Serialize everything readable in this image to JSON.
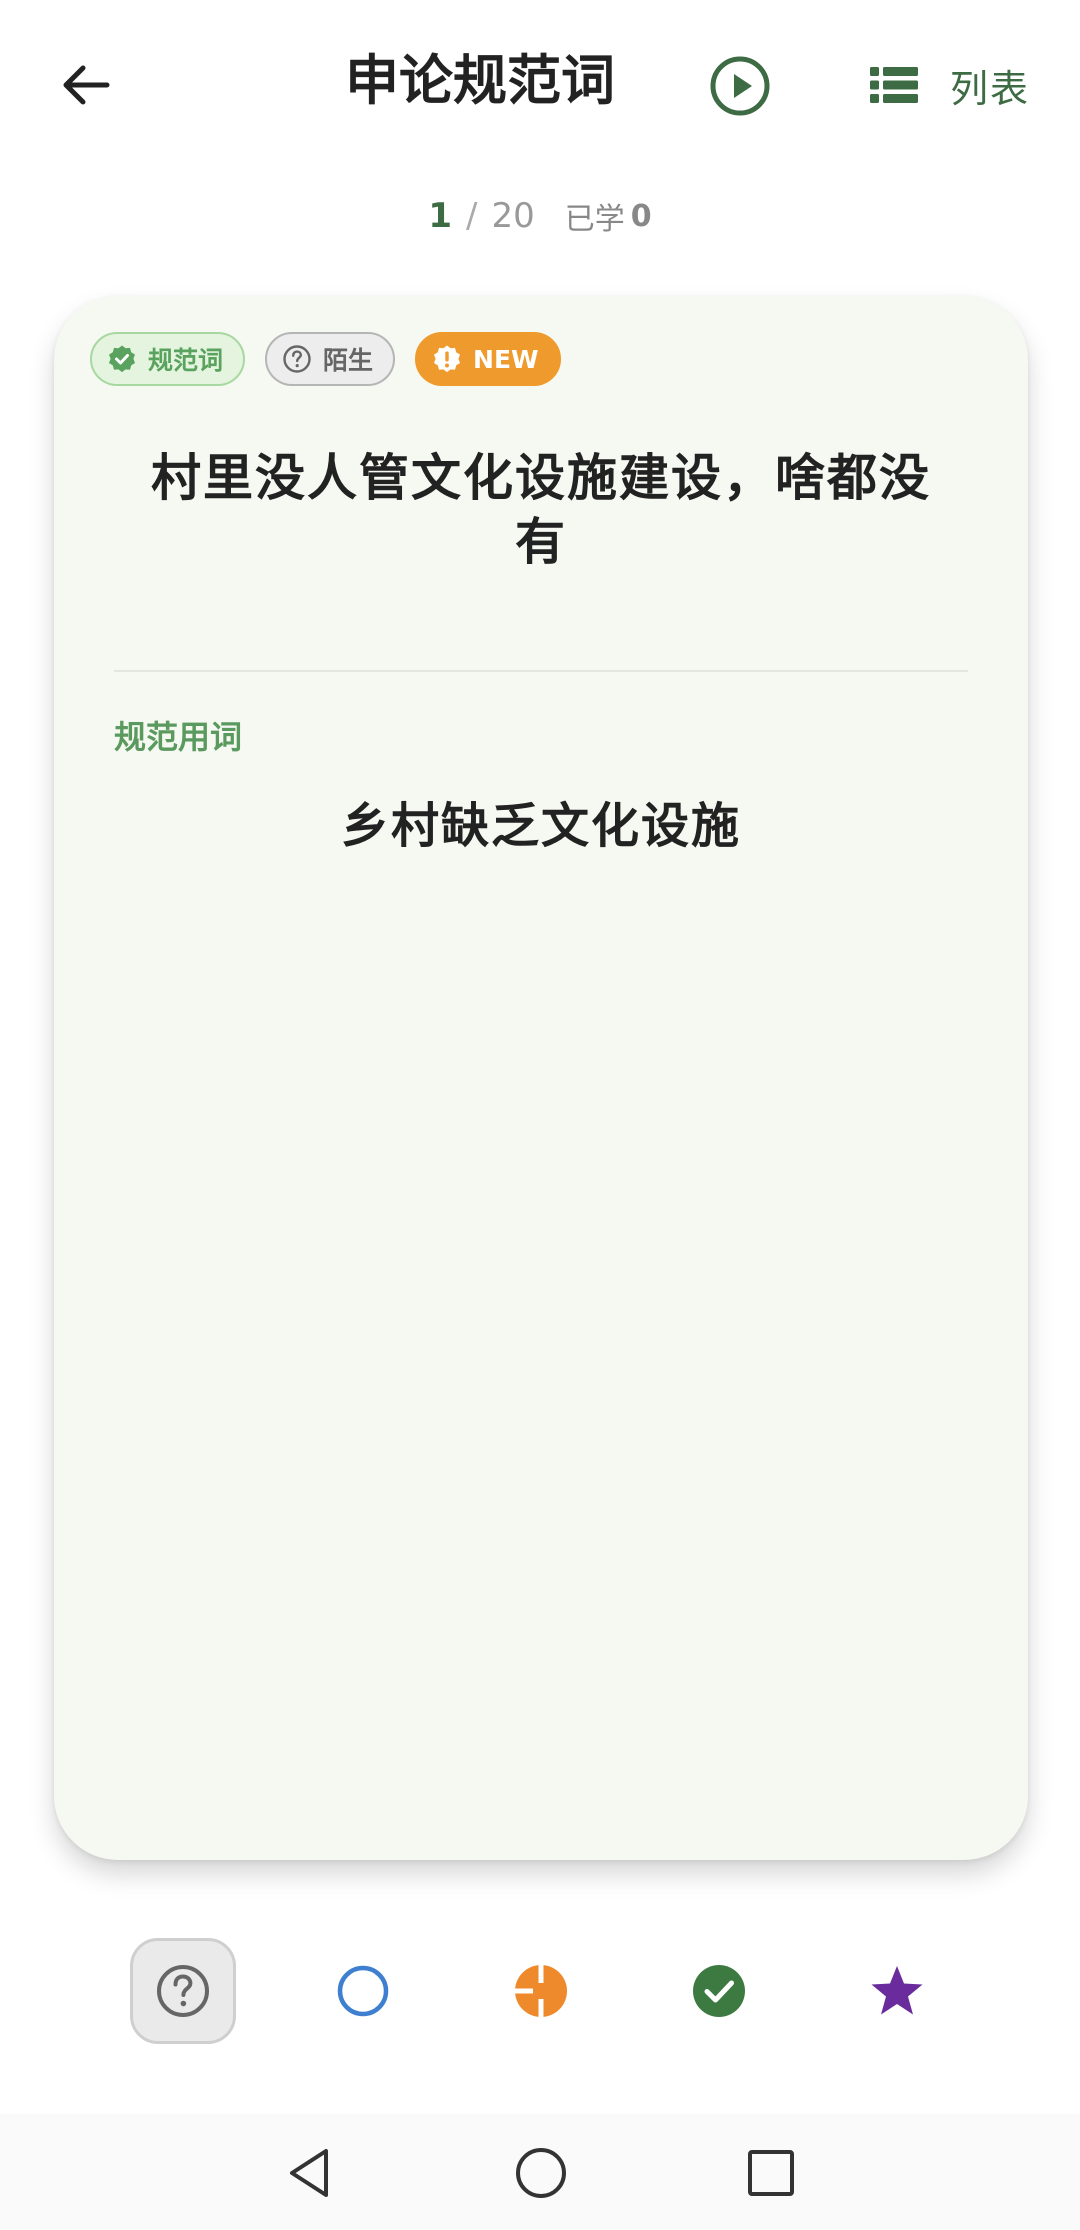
{
  "header": {
    "title": "申论规范词",
    "list_label": "列表"
  },
  "progress": {
    "current": "1",
    "separator": "/",
    "total": "20",
    "learned_label": "已学",
    "learned_count": "0"
  },
  "card": {
    "tags": {
      "standard": "规范词",
      "unfamiliar": "陌生",
      "new": "NEW"
    },
    "phrase": "村里没人管文化设施建设，啥都没有",
    "section_label": "规范用词",
    "standard_term": "乡村缺乏文化设施"
  },
  "status_buttons": [
    {
      "icon": "question-circle-icon",
      "color": "#666666"
    },
    {
      "icon": "empty-circle-icon",
      "color": "#3f7fd0"
    },
    {
      "icon": "half-circle-icon",
      "color": "#ef8a2c"
    },
    {
      "icon": "check-circle-icon",
      "color": "#3d7a42"
    },
    {
      "icon": "star-icon",
      "color": "#6a2c9c"
    }
  ],
  "colors": {
    "accent": "#3d6b43",
    "card_background": "#f6f9f2",
    "tag_new": "#ef9a2c"
  }
}
